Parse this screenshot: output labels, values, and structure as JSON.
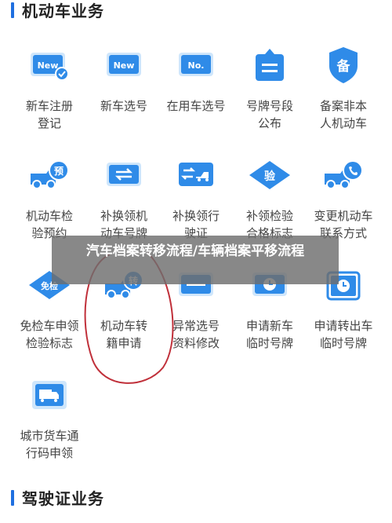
{
  "sections": {
    "vehicle": {
      "title": "机动车业务"
    },
    "license": {
      "title": "驾驶证业务"
    }
  },
  "banner": {
    "text": "汽车档案转移流程/车辆档案平移流程"
  },
  "items": [
    {
      "label": "新车注册\n登记",
      "icon": "new-car-register-icon"
    },
    {
      "label": "新车选号",
      "icon": "new-car-plate-select-icon"
    },
    {
      "label": "在用车选号",
      "icon": "used-car-plate-select-icon"
    },
    {
      "label": "号牌号段\n公布",
      "icon": "plate-segment-announce-icon"
    },
    {
      "label": "备案非本\n人机动车",
      "icon": "record-non-owner-vehicle-icon"
    },
    {
      "label": "机动车检\n验预约",
      "icon": "inspection-appointment-icon"
    },
    {
      "label": "补换领机\n动车号牌",
      "icon": "replace-plate-icon"
    },
    {
      "label": "补换领行\n驶证",
      "icon": "replace-driving-permit-icon"
    },
    {
      "label": "补领检验\n合格标志",
      "icon": "reissue-inspection-mark-icon"
    },
    {
      "label": "变更机动车\n联系方式",
      "icon": "change-contact-icon"
    },
    {
      "label": "免检车申领\n检验标志",
      "icon": "exempt-inspection-mark-icon"
    },
    {
      "label": "机动车转\n籍申请",
      "icon": "vehicle-transfer-icon"
    },
    {
      "label": "异常选号\n资料修改",
      "icon": "abnormal-plate-edit-icon"
    },
    {
      "label": "申请新车\n临时号牌",
      "icon": "new-car-temp-plate-icon"
    },
    {
      "label": "申请转出车\n临时号牌",
      "icon": "transfer-temp-plate-icon"
    },
    {
      "label": "城市货车通\n行码申领",
      "icon": "truck-pass-code-icon"
    }
  ],
  "icon_texts": {
    "new": "New",
    "no": "No.",
    "yu": "预",
    "yan": "验",
    "mianjian": "免检",
    "zhuan": "转",
    "bei": "备"
  },
  "colors": {
    "accent": "#2f8be8",
    "section_bar": "#1f6fe0",
    "annotation": "#c0303a"
  }
}
